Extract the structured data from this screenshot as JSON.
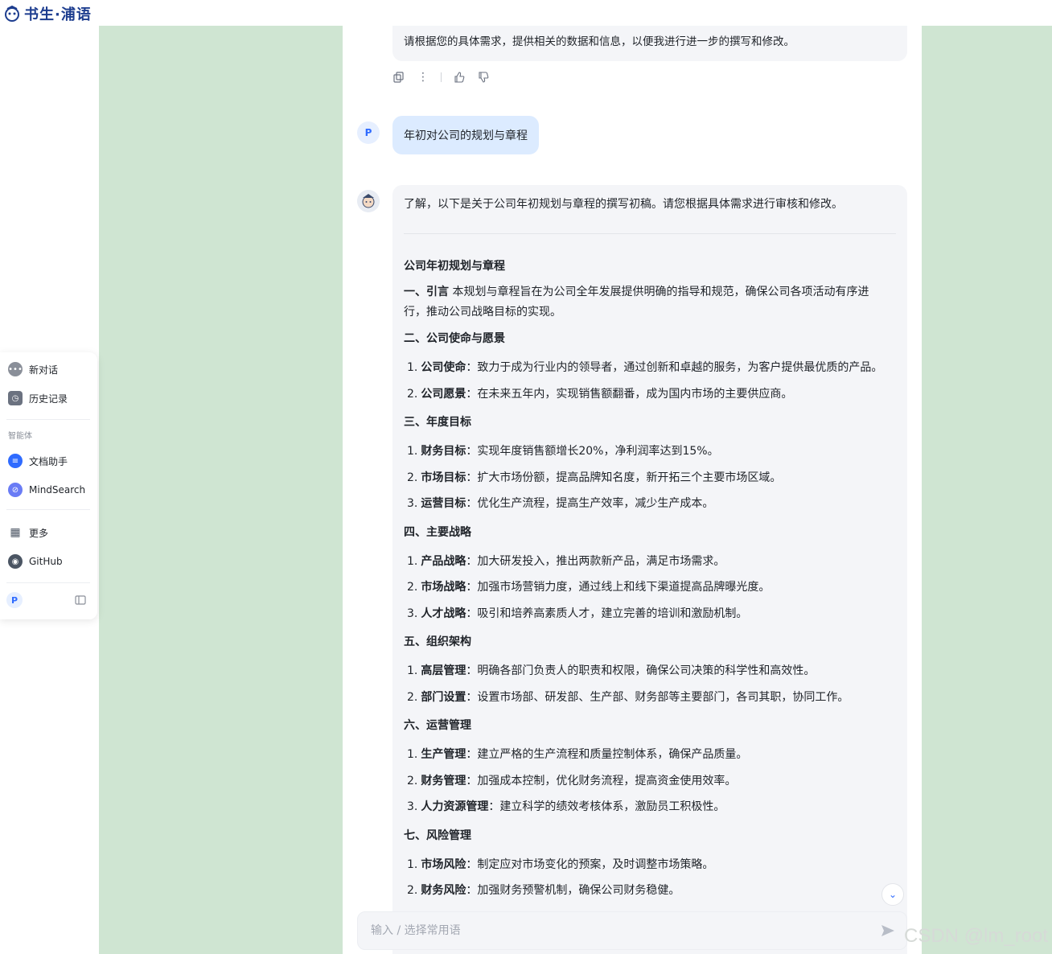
{
  "header": {
    "logo_text": "书生·浦语"
  },
  "sidebar": {
    "items": [
      {
        "label": "新对话",
        "icon": "chat-bubble-icon"
      },
      {
        "label": "历史记录",
        "icon": "history-icon"
      }
    ],
    "section_label": "智能体",
    "agents": [
      {
        "label": "文档助手",
        "icon": "document-icon"
      },
      {
        "label": "MindSearch",
        "icon": "mindsearch-icon"
      }
    ],
    "extra": [
      {
        "label": "更多",
        "icon": "grid-icon"
      },
      {
        "label": "GitHub",
        "icon": "github-icon"
      }
    ],
    "user_initial": "P"
  },
  "chat": {
    "prev_reply_tail": "请根据您的具体需求，提供相关的数据和信息，以便我进行进一步的撰写和修改。",
    "user_initial": "P",
    "user_message": "年初对公司的规划与章程",
    "bot_intro": "了解，以下是关于公司年初规划与章程的撰写初稿。请您根据具体需求进行审核和修改。",
    "doc_title": "公司年初规划与章程",
    "intro_label": "一、引言",
    "intro_text_1": "本规划与章程旨在为公司全年发展提供明确的指导和规范，确保公司各项活动有序进",
    "intro_text_2": "行，推动公司战略目标的实现。",
    "sections": [
      {
        "title": "二、公司使命与愿景",
        "items": [
          {
            "no": "1.",
            "label": "公司使命",
            "text": "：致力于成为行业内的领导者，通过创新和卓越的服务，为客户提供最优质的产品。"
          },
          {
            "no": "2.",
            "label": "公司愿景",
            "text": "：在未来五年内，实现销售额翻番，成为国内市场的主要供应商。"
          }
        ]
      },
      {
        "title": "三、年度目标",
        "items": [
          {
            "no": "1.",
            "label": "财务目标",
            "text": "：实现年度销售额增长20%，净利润率达到15%。"
          },
          {
            "no": "2.",
            "label": "市场目标",
            "text": "：扩大市场份额，提高品牌知名度，新开拓三个主要市场区域。"
          },
          {
            "no": "3.",
            "label": "运营目标",
            "text": "：优化生产流程，提高生产效率，减少生产成本。"
          }
        ]
      },
      {
        "title": "四、主要战略",
        "items": [
          {
            "no": "1.",
            "label": "产品战略",
            "text": "：加大研发投入，推出两款新产品，满足市场需求。"
          },
          {
            "no": "2.",
            "label": "市场战略",
            "text": "：加强市场营销力度，通过线上和线下渠道提高品牌曝光度。"
          },
          {
            "no": "3.",
            "label": "人才战略",
            "text": "：吸引和培养高素质人才，建立完善的培训和激励机制。"
          }
        ]
      },
      {
        "title": "五、组织架构",
        "items": [
          {
            "no": "1.",
            "label": "高层管理",
            "text": "：明确各部门负责人的职责和权限，确保公司决策的科学性和高效性。"
          },
          {
            "no": "2.",
            "label": "部门设置",
            "text": "：设置市场部、研发部、生产部、财务部等主要部门，各司其职，协同工作。"
          }
        ]
      },
      {
        "title": "六、运营管理",
        "items": [
          {
            "no": "1.",
            "label": "生产管理",
            "text": "：建立严格的生产流程和质量控制体系，确保产品质量。"
          },
          {
            "no": "2.",
            "label": "财务管理",
            "text": "：加强成本控制，优化财务流程，提高资金使用效率。"
          },
          {
            "no": "3.",
            "label": "人力资源管理",
            "text": "：建立科学的绩效考核体系，激励员工积极性。"
          }
        ]
      },
      {
        "title": "七、风险管理",
        "items": [
          {
            "no": "1.",
            "label": "市场风险",
            "text": "：制定应对市场变化的预案，及时调整市场策略。"
          },
          {
            "no": "2.",
            "label": "财务风险",
            "text": "：加强财务预警机制，确保公司财务稳健。"
          }
        ]
      }
    ],
    "input_placeholder": "输入 / 选择常用语"
  },
  "watermark": "CSDN @lm_root",
  "colors": {
    "accent": "#2f6bff",
    "bg_green": "#cfe5d2",
    "bubble": "#f4f5f8",
    "user_bubble": "#dcebff"
  }
}
